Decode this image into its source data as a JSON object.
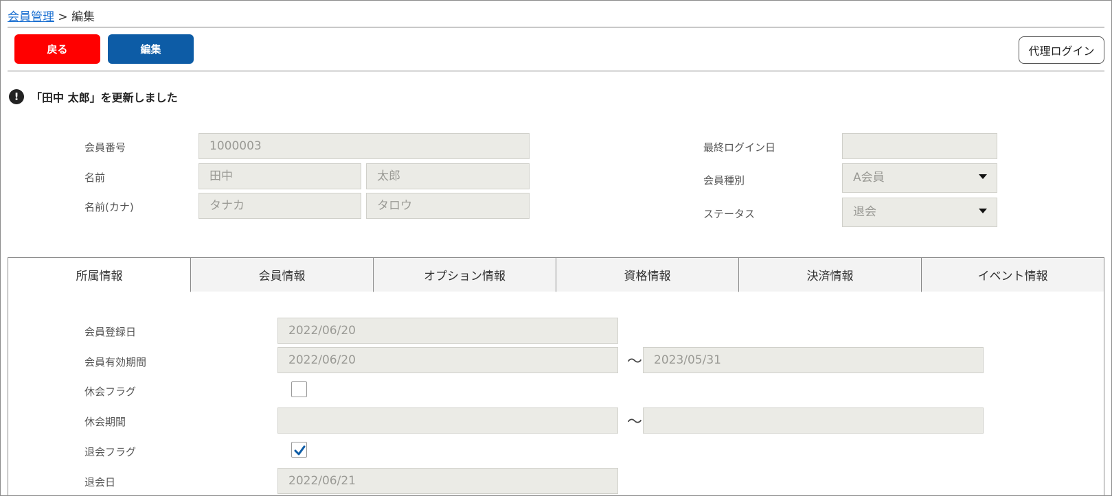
{
  "breadcrumb": {
    "parent": "会員管理",
    "separator": " > ",
    "current": "編集"
  },
  "toolbar": {
    "back_label": "戻る",
    "edit_label": "編集",
    "proxy_login_label": "代理ログイン"
  },
  "notice": {
    "message": "「田中 太郎」を更新しました"
  },
  "member": {
    "number_label": "会員番号",
    "number_value": "1000003",
    "name_label": "名前",
    "last_name": "田中",
    "first_name": "太郎",
    "kana_label": "名前(カナ)",
    "last_kana": "タナカ",
    "first_kana": "タロウ",
    "last_login_label": "最終ログイン日",
    "last_login_value": "",
    "type_label": "会員種別",
    "type_value": "A会員",
    "status_label": "ステータス",
    "status_value": "退会"
  },
  "tabs": [
    {
      "label": "所属情報"
    },
    {
      "label": "会員情報"
    },
    {
      "label": "オプション情報"
    },
    {
      "label": "資格情報"
    },
    {
      "label": "決済情報"
    },
    {
      "label": "イベント情報"
    }
  ],
  "detail": {
    "registered_label": "会員登録日",
    "registered_value": "2022/06/20",
    "validity_label": "会員有効期間",
    "validity_from": "2022/06/20",
    "validity_to": "2023/05/31",
    "tilde": "〜",
    "suspend_flag_label": "休会フラグ",
    "suspend_flag_checked": false,
    "suspend_period_label": "休会期間",
    "suspend_from": "",
    "suspend_to": "",
    "withdraw_flag_label": "退会フラグ",
    "withdraw_flag_checked": true,
    "withdraw_date_label": "退会日",
    "withdraw_date_value": "2022/06/21"
  },
  "colors": {
    "back": "#ff0000",
    "edit": "#0d5ca6",
    "link": "#1a6fd1",
    "check": "#0d5ca6"
  }
}
